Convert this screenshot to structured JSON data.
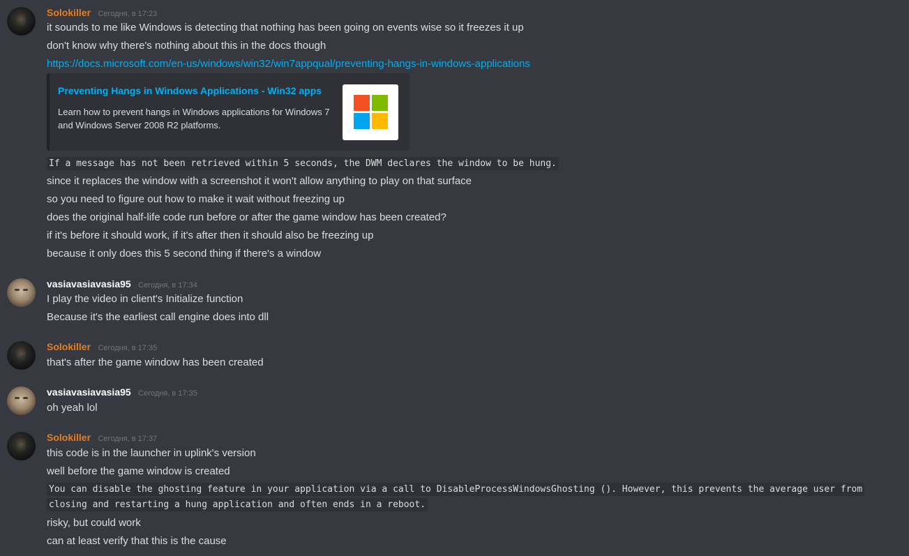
{
  "colors": {
    "background": "#36393f",
    "solokiller_name": "#e67e22",
    "vasia_name": "#ffffff",
    "link": "#00b0f4",
    "code_bg": "#2f3136",
    "embed_bg": "#2f3136",
    "ms_red": "#f25022",
    "ms_green": "#7fba00",
    "ms_blue": "#00a4ef",
    "ms_yellow": "#ffb900"
  },
  "messages": [
    {
      "author": "Solokiller",
      "timestamp": "Сегодня, в 17:23",
      "avatar_icon": "dark-hooded-avatar",
      "lines": [
        "it sounds to me like Windows is detecting that nothing has been going on events wise so it freezes it up",
        "don't know why there's nothing about this in the docs though",
        "https://docs.microsoft.com/en-us/windows/win32/win7appqual/preventing-hangs-in-windows-applications"
      ],
      "embed": {
        "title": "Preventing Hangs in Windows Applications - Win32 apps",
        "description": "Learn how to prevent hangs in Windows applications for Windows 7 and Windows Server 2008 R2 platforms.",
        "thumbnail_icon": "microsoft-logo-icon"
      },
      "code_line": "If a message has not been retrieved within 5 seconds, the DWM declares the window to be hung.",
      "after_lines": [
        "since it replaces the window with a screenshot it won't allow anything to play on that surface",
        "so you need to figure out how to make it wait without freezing up",
        "does the original half-life code run before or after the game window has been created?",
        "if it's before it should work, if it's after then it should also be freezing up",
        "because it only does this 5 second thing if there's a window"
      ]
    },
    {
      "author": "vasiavasiavasia95",
      "timestamp": "Сегодня, в 17:34",
      "avatar_icon": "face-avatar",
      "lines": [
        "I play the video in client's Initialize function",
        "Because it's the earliest call engine does into dll"
      ]
    },
    {
      "author": "Solokiller",
      "timestamp": "Сегодня, в 17:35",
      "avatar_icon": "dark-hooded-avatar",
      "lines": [
        "that's after the game window has been created"
      ]
    },
    {
      "author": "vasiavasiavasia95",
      "timestamp": "Сегодня, в 17:35",
      "avatar_icon": "face-avatar",
      "lines": [
        "oh yeah lol"
      ]
    },
    {
      "author": "Solokiller",
      "timestamp": "Сегодня, в 17:37",
      "avatar_icon": "dark-hooded-avatar",
      "lines": [
        "this code is in the launcher in uplink's version",
        "well before the game window is created"
      ],
      "code_block": "You can disable the ghosting feature in your application via a call to DisableProcessWindowsGhosting (). However, this prevents the average user from closing and restarting a hung application and often ends in a reboot.",
      "after_lines": [
        "risky, but could work",
        "can at least verify that this is the cause"
      ]
    }
  ]
}
